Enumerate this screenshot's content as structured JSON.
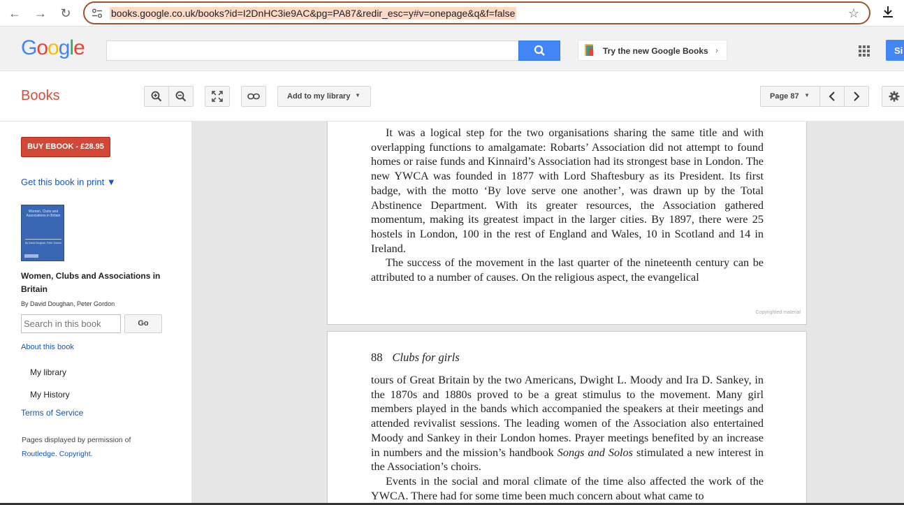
{
  "browser": {
    "url": "books.google.co.uk/books?id=I2DnHC3ie9AC&pg=PA87&redir_esc=y#v=onepage&q&f=false"
  },
  "header": {
    "logo_letters": [
      "G",
      "o",
      "o",
      "g",
      "l",
      "e"
    ],
    "logo_colors": [
      "#4285f4",
      "#ea4335",
      "#fbbc05",
      "#4285f4",
      "#34a853",
      "#ea4335"
    ],
    "try_books_label": "Try the new Google Books",
    "signin_label": "Si"
  },
  "toolbar": {
    "books_title": "Books",
    "add_library_label": "Add to my library",
    "page_label": "Page 87"
  },
  "sidebar": {
    "buy_label": "BUY EBOOK - £28.95",
    "get_print_label": "Get this book in print ▼",
    "cover_title": "Women, Clubs and Associations in Britain",
    "book_title": "Women, Clubs and Associations in Britain",
    "byline": "By David Doughan, Peter Gordon",
    "search_placeholder": "Search in this book",
    "go_label": "Go",
    "about_label": "About this book",
    "my_library": "My library",
    "my_history": "My History",
    "terms": "Terms of Service",
    "permission_text": "Pages displayed by permission of",
    "publisher": "Routledge",
    "copyright_link": "Copyright"
  },
  "page1": {
    "paragraphs": [
      "It was a logical step for the two organisations sharing the same title and with overlapping functions to amalgamate: Robarts’ Association did not attempt to found homes or raise funds and Kinnaird’s Association had its strongest base in London. The new YWCA was founded in 1877 with Lord Shaftesbury as its President. Its first badge, with the motto ‘By love serve one another’, was drawn up by the Total Abstinence Department. With its greater resources, the Association gathered momentum, making its greatest impact in the larger cities. By 1897, there were 25 hostels in London, 100 in the rest of England and Wales, 10 in Scotland and 14 in Ireland.",
      "The success of the movement in the last quarter of the nineteenth century can be attributed to a number of causes. On the religious aspect, the evangelical"
    ],
    "copyright_mark": "Copyrighted material"
  },
  "page2": {
    "page_number": "88",
    "running_title": "Clubs for girls",
    "para1_before": "tours of Great Britain by the two Americans, Dwight L. Moody and Ira D. Sankey, in the 1870s and 1880s proved to be a great stimulus to the movement. Many girl members played in the bands which accompanied the speakers at their meetings and attended revivalist sessions. The leading women of the Association also entertained Moody and Sankey in their London homes. Prayer meetings benefited by an increase in numbers and the mission’s handbook ",
    "para1_italic": "Songs and Solos",
    "para1_after": " stimulated a new interest in the Association’s choirs.",
    "para2": "Events in the social and moral climate of the time also affected the work of the YWCA. There had for some time been much concern about what came to"
  }
}
